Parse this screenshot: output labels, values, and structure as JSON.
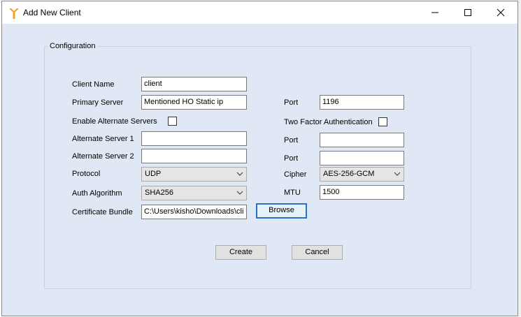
{
  "window": {
    "title": "Add New Client"
  },
  "group": {
    "label": "Configuration"
  },
  "left_fields": {
    "client_name": {
      "label": "Client Name",
      "value": "client"
    },
    "primary_server": {
      "label": "Primary Server",
      "value": "Mentioned HO Static ip"
    },
    "enable_alternate": {
      "label": "Enable Alternate Servers"
    },
    "alt_server_1": {
      "label": "Alternate Server 1",
      "value": ""
    },
    "alt_server_2": {
      "label": "Alternate Server 2",
      "value": ""
    },
    "protocol": {
      "label": "Protocol",
      "value": "UDP"
    },
    "auth_algorithm": {
      "label": "Auth Algorithm",
      "value": "SHA256"
    },
    "certificate_bundle": {
      "label": "Certificate Bundle",
      "value": "C:\\Users\\kisho\\Downloads\\cli"
    }
  },
  "right_fields": {
    "port": {
      "label": "Port",
      "value": "1196"
    },
    "two_factor": {
      "label": "Two Factor Authentication"
    },
    "alt_port_1": {
      "label": "Port",
      "value": ""
    },
    "alt_port_2": {
      "label": "Port",
      "value": ""
    },
    "cipher": {
      "label": "Cipher",
      "value": "AES-256-GCM"
    },
    "mtu": {
      "label": "MTU",
      "value": "1500"
    }
  },
  "buttons": {
    "browse": "Browse",
    "create": "Create",
    "cancel": "Cancel"
  },
  "colors": {
    "dialog_bg": "#dfe8f4",
    "focus_blue": "#2a72c9",
    "icon_orange": "#f0a030"
  }
}
